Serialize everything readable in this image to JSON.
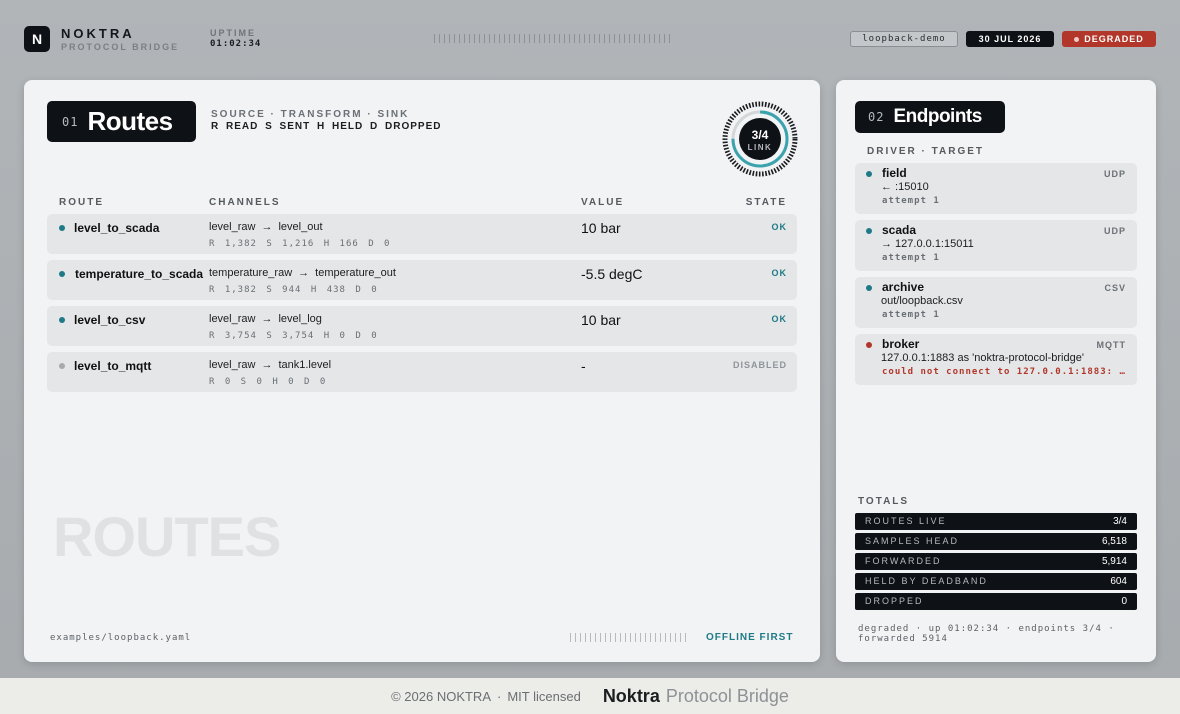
{
  "header": {
    "logo_letter": "N",
    "brand_name": "NOKTRA",
    "brand_sub": "PROTOCOL BRIDGE",
    "uptime_label": "UPTIME",
    "uptime_value": "01:02:34",
    "environment": "loopback-demo",
    "date": "30 JUL 2026",
    "status": "DEGRADED"
  },
  "routes": {
    "number": "01",
    "title": "Routes",
    "legend_top": "SOURCE · TRANSFORM · SINK",
    "legend_bottom": "R READ S SENT H HELD D DROPPED",
    "gauge": {
      "value": "3/4",
      "label": "LINK",
      "fraction": 0.75
    },
    "columns": {
      "route": "ROUTE",
      "channels": "CHANNELS",
      "value": "VALUE",
      "state": "STATE"
    },
    "items": [
      {
        "name": "level_to_scada",
        "source": "level_raw",
        "arrow": "→",
        "sink": "level_out",
        "stats": "R 1,382 S 1,216 H 166 D 0",
        "value": "10 bar",
        "state": "OK"
      },
      {
        "name": "temperature_to_scada",
        "source": "temperature_raw",
        "arrow": "→",
        "sink": "temperature_out",
        "stats": "R 1,382 S 944 H 438 D 0",
        "value": "-5.5 degC",
        "state": "OK"
      },
      {
        "name": "level_to_csv",
        "source": "level_raw",
        "arrow": "→",
        "sink": "level_log",
        "stats": "R 3,754 S 3,754 H 0 D 0",
        "value": "10 bar",
        "state": "OK"
      },
      {
        "name": "level_to_mqtt",
        "source": "level_raw",
        "arrow": "→",
        "sink": "tank1.level",
        "stats": "R 0 S 0 H 0 D 0",
        "value": "-",
        "state": "DISABLED"
      }
    ],
    "watermark": "ROUTES",
    "footer_file": "examples/loopback.yaml",
    "footer_tag": "OFFLINE FIRST"
  },
  "endpoints": {
    "number": "02",
    "title": "Endpoints",
    "header": "DRIVER · TARGET",
    "items": [
      {
        "name": "field",
        "driver": "UDP",
        "target": "← :15010",
        "detail": "attempt 1"
      },
      {
        "name": "scada",
        "driver": "UDP",
        "target": "→ 127.0.0.1:15011",
        "detail": "attempt 1"
      },
      {
        "name": "archive",
        "driver": "CSV",
        "target": "out/loopback.csv",
        "detail": "attempt 1"
      },
      {
        "name": "broker",
        "driver": "MQTT",
        "target": "127.0.0.1:1883 as 'noktra-protocol-bridge'",
        "detail": "could not connect to 127.0.0.1:1883: Co..."
      }
    ],
    "totals_label": "TOTALS",
    "totals": [
      {
        "label": "ROUTES LIVE",
        "value": "3/4"
      },
      {
        "label": "SAMPLES HEAD",
        "value": "6,518"
      },
      {
        "label": "FORWARDED",
        "value": "5,914"
      },
      {
        "label": "HELD BY DEADBAND",
        "value": "604"
      },
      {
        "label": "DROPPED",
        "value": "0"
      }
    ],
    "summary": "degraded · up 01:02:34 · endpoints 3/4 · forwarded 5914"
  },
  "footer": {
    "copyright": "© 2026 NOKTRA",
    "separator": "·",
    "license": "MIT licensed",
    "product_bold": "Noktra",
    "product_rest": "Protocol Bridge"
  },
  "colors": {
    "accent": "#1f7a86",
    "error": "#b2372a",
    "dark": "#0e1115"
  }
}
